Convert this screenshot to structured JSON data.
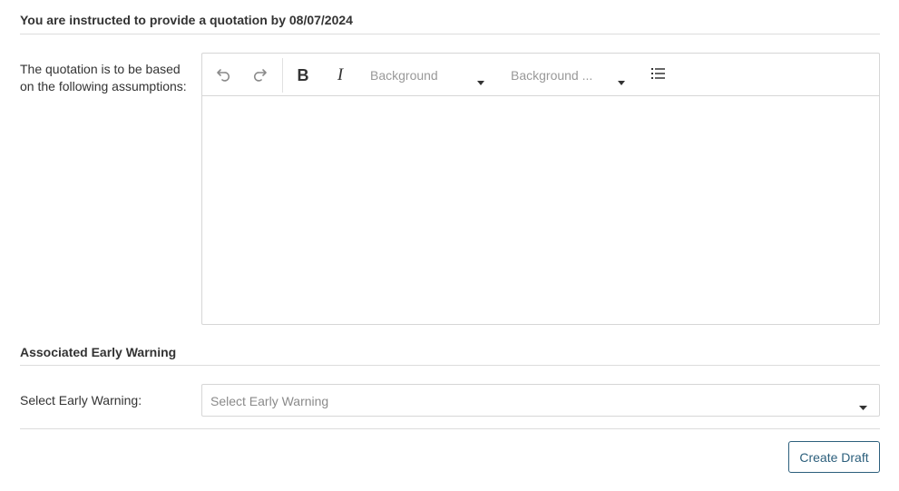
{
  "instruction": {
    "heading": "You are instructed to provide a quotation by 08/07/2024"
  },
  "assumptions": {
    "label": "The quotation is to be based on the following assumptions:",
    "editor": {
      "toolbar": {
        "undo_icon": "undo-icon",
        "redo_icon": "redo-icon",
        "bold_label": "B",
        "italic_label": "I",
        "background_select": "Background",
        "background_color_select": "Background ...",
        "list_icon": "bulleted-list-icon"
      },
      "content": ""
    }
  },
  "early_warning": {
    "section_title": "Associated Early Warning",
    "select_label": "Select Early Warning:",
    "select_placeholder": "Select Early Warning"
  },
  "actions": {
    "create_draft_label": "Create Draft"
  },
  "colors": {
    "primary_button": "#2c5f7c",
    "border": "#d6d6d6",
    "divider": "#dcdcdc",
    "placeholder_text": "#999999"
  }
}
